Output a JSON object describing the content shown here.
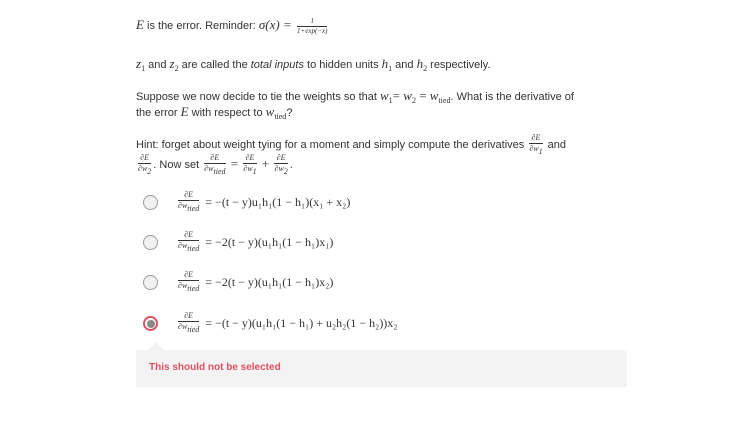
{
  "intro": {
    "line1_text": " is the error. Reminder: ",
    "sigma": "σ(x) = ",
    "sigma_num": "1",
    "sigma_den": "1+exp(−x)"
  },
  "totals": {
    "z1": "z",
    "mid": " and ",
    "z2": "z",
    "text": " are called the ",
    "em": "total inputs",
    "text2": " to hidden units ",
    "h1": "h",
    "and": " and ",
    "h2": "h",
    "end": " respectively."
  },
  "question": {
    "part1": "Suppose we now decide to tie the weights so that ",
    "eq": "= ",
    "eq2": " = ",
    "part2": ". What is the derivative of",
    "part3": "the error ",
    "part4": " with respect to ",
    "end": "?"
  },
  "hint": {
    "part1": "Hint: forget about weight tying for a moment and simply compute the derivatives ",
    "and": " and",
    "now_set": ". Now set ",
    "eq": " = ",
    "plus": " + ",
    "period": "."
  },
  "symbols": {
    "E": "E",
    "w": "w",
    "tied": "tied",
    "one": "1",
    "two": "2",
    "dE": "∂E",
    "dw1": "∂w",
    "dwtied": "∂w"
  },
  "options": [
    {
      "expr": "= −(t − y)u₁h₁(1 − h₁)(x₁ + x₂)",
      "selected": false
    },
    {
      "expr": "= −2(t − y)(u₁h₁(1 − h₁)x₁)",
      "selected": false
    },
    {
      "expr": "= −2(t − y)(u₁h₁(1 − h₁)x₂)",
      "selected": false
    },
    {
      "expr": "= −(t − y)(u₁h₁(1 − h₁) + u₂h₂(1 − h₂))x₂",
      "selected": true
    }
  ],
  "feedback": {
    "text": "This should not be selected",
    "color": "#e05060"
  }
}
